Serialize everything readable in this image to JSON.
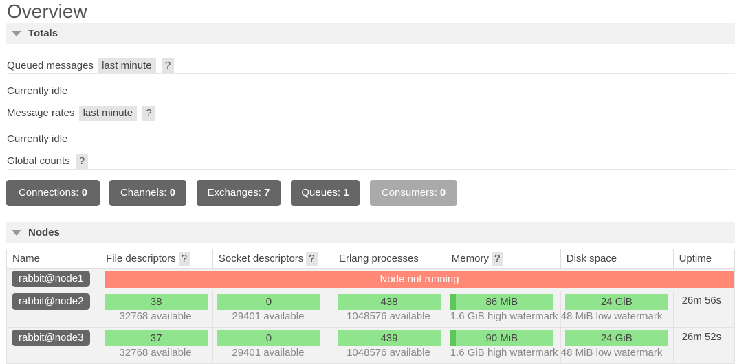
{
  "page": {
    "title": "Overview"
  },
  "totals": {
    "header": "Totals",
    "queued_label": "Queued messages",
    "queued_range": "last minute",
    "queued_help": "?",
    "queued_idle": "Currently idle",
    "rates_label": "Message rates",
    "rates_range": "last minute",
    "rates_help": "?",
    "rates_idle": "Currently idle",
    "global_label": "Global counts",
    "global_help": "?",
    "counts": [
      {
        "label": "Connections:",
        "value": "0"
      },
      {
        "label": "Channels:",
        "value": "0"
      },
      {
        "label": "Exchanges:",
        "value": "7"
      },
      {
        "label": "Queues:",
        "value": "1"
      },
      {
        "label": "Consumers:",
        "value": "0"
      }
    ]
  },
  "nodes": {
    "header": "Nodes",
    "columns": [
      "Name",
      "File descriptors",
      "Socket descriptors",
      "Erlang processes",
      "Memory",
      "Disk space",
      "Uptime"
    ],
    "help": "?",
    "rows": [
      {
        "name": "rabbit@node1",
        "status": "Node not running"
      },
      {
        "name": "rabbit@node2",
        "fd": "38",
        "fd_avail": "32768 available",
        "sock": "0",
        "sock_avail": "29401 available",
        "proc": "438",
        "proc_avail": "1048576 available",
        "mem": "86 MiB",
        "mem_sub": "1.6 GiB high watermark",
        "disk": "24 GiB",
        "disk_sub": "48 MiB low watermark",
        "uptime": "26m 56s"
      },
      {
        "name": "rabbit@node3",
        "fd": "37",
        "fd_avail": "32768 available",
        "sock": "0",
        "sock_avail": "29401 available",
        "proc": "439",
        "proc_avail": "1048576 available",
        "mem": "90 MiB",
        "mem_sub": "1.6 GiB high watermark",
        "disk": "24 GiB",
        "disk_sub": "48 MiB low watermark",
        "uptime": "26m 52s"
      }
    ]
  },
  "colors": {
    "ok": "#90e48d",
    "ok_fill": "#5cc659",
    "error": "#ff8877",
    "badge": "#666666"
  }
}
